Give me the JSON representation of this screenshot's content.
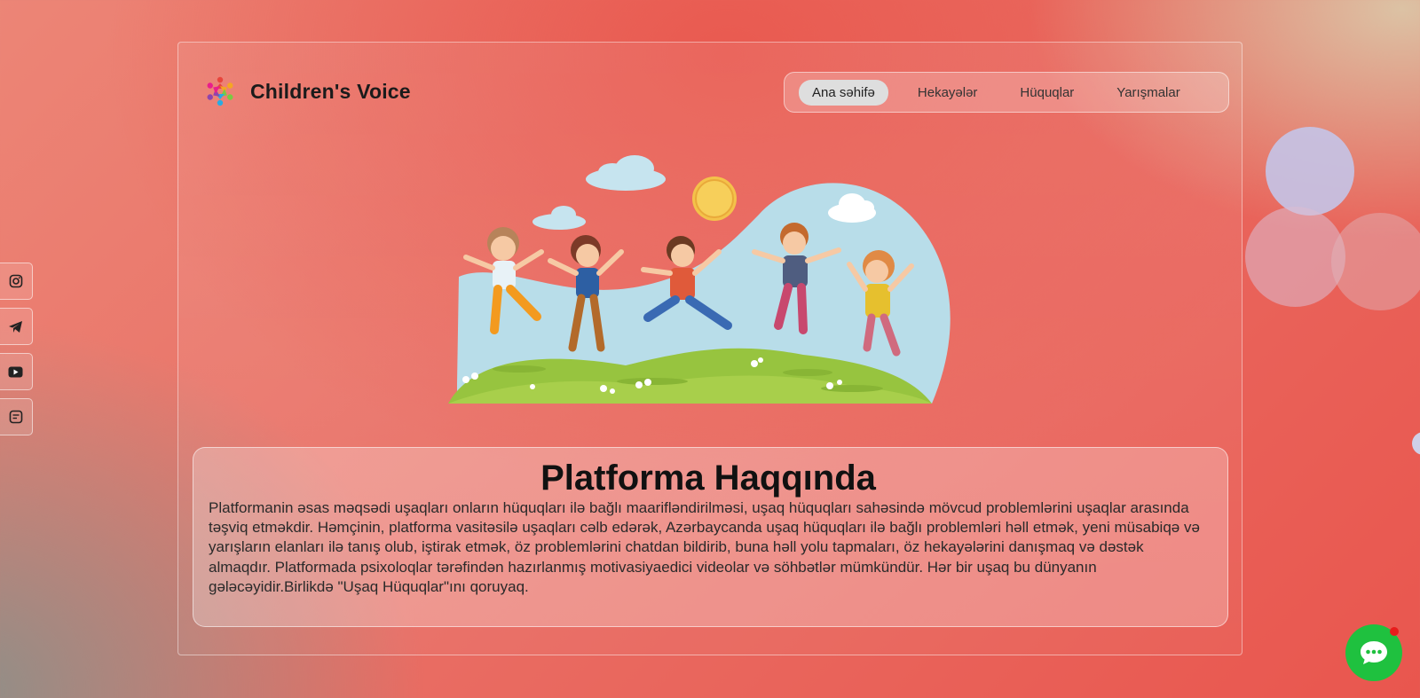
{
  "brand": {
    "name": "Children's Voice",
    "logo_icon": "people-circle-logo-icon"
  },
  "nav": {
    "items": [
      {
        "label": "Ana səhifə",
        "active": true
      },
      {
        "label": "Hekayələr",
        "active": false
      },
      {
        "label": "Hüquqlar",
        "active": false
      },
      {
        "label": "Yarışmalar",
        "active": false
      }
    ]
  },
  "hero": {
    "illustration": "jumping-children-illustration"
  },
  "about": {
    "title": "Platforma Haqqında",
    "text": "Platformanin əsas məqsədi uşaqları onların hüquqları ilə bağlı maarifləndirilməsi, uşaq hüquqları sahəsində mövcud problemlərini uşaqlar arasında təşviq etməkdir. Həmçinin, platforma vasitəsilə uşaqları cəlb edərək, Azərbaycanda uşaq hüquqları ilə bağlı problemləri həll etmək, yeni müsabiqə və yarışların elanları ilə tanış olub, iştirak etmək, öz problemlərini chatdan bildirib, buna həll yolu tapmaları, öz hekayələrini danışmaq və dəstək almaqdır. Platformada psixoloqlar tərəfindən hazırlanmış motivasiyaedici videolar və söhbətlər mümkündür. Hər bir uşaq bu dünyanın gələcəyidir.Birlikdə \"Uşaq Hüquqlar\"ını qoruyaq."
  },
  "social": [
    "instagram-icon",
    "telegram-icon",
    "youtube-icon",
    "message-icon"
  ],
  "chat": {
    "icon": "chat-bubble-icon",
    "has_notification": true
  },
  "colors": {
    "active_nav": "#dedede",
    "chat_green": "#1fc13f",
    "notification_red": "#e81c1c"
  }
}
